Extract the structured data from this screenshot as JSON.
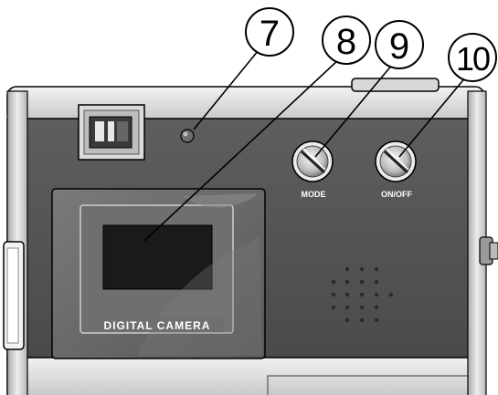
{
  "callouts": [
    {
      "number": "7"
    },
    {
      "number": "8"
    },
    {
      "number": "9"
    },
    {
      "number": "10"
    }
  ],
  "buttons": {
    "mode_label": "MODE",
    "power_label": "ON/OFF"
  },
  "lcd": {
    "label": "DIGITAL CAMERA"
  },
  "colors": {
    "body_band": "#555555",
    "silver": "#d8d8d8",
    "lcd_frame": "#6b6b6b",
    "screen": "#1a1a1a",
    "outline": "#000000"
  }
}
